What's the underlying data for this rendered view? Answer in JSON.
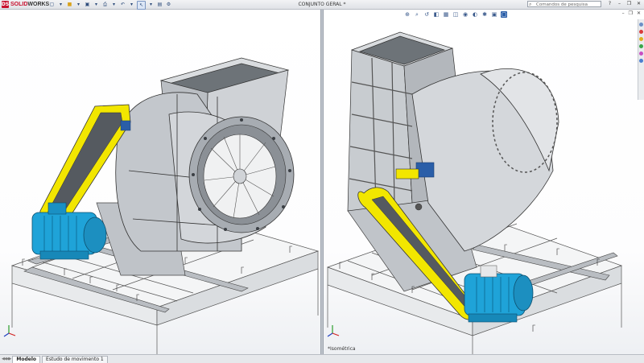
{
  "app": {
    "brand_prefix": "DS",
    "brand_name_red": "SOLID",
    "brand_name_rest": "WORKS",
    "document_title": "CONJUNTO GERAL *"
  },
  "search": {
    "placeholder": "Comandos de pesquisa"
  },
  "heads_up_icons": [
    "zoom-fit-icon",
    "zoom-area-icon",
    "previous-view-icon",
    "section-view-icon",
    "dynamic-annotation-icon",
    "view-orientation-icon",
    "display-style-icon",
    "hide-show-icon",
    "edit-appearance-icon",
    "scene-icon",
    "view-settings-icon"
  ],
  "viewports": {
    "left": {
      "view_label": ""
    },
    "right": {
      "view_label": "*Isométrica"
    }
  },
  "bottom_tabs": [
    {
      "label": "Modelo",
      "active": true
    },
    {
      "label": "Estudo de movimento 1",
      "active": false
    }
  ],
  "colors": {
    "belt": "#f2e600",
    "motor": "#1fa3d8",
    "steel": "#c9cdd2",
    "selection_blue": "#2a5ea8"
  }
}
